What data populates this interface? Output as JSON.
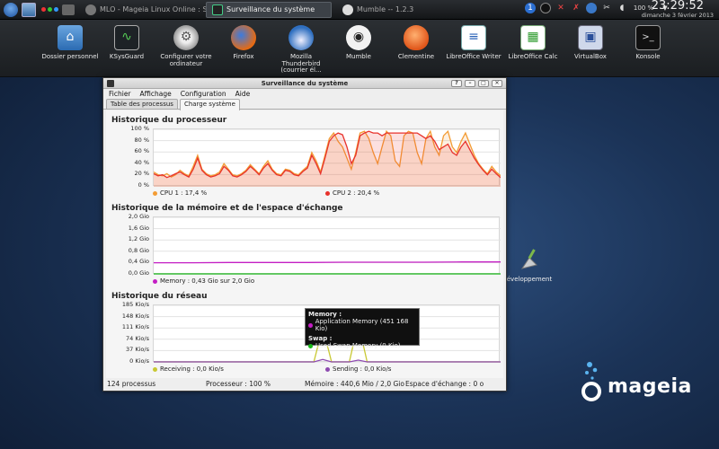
{
  "taskbar": {
    "tasks": [
      {
        "label": "MLO - Mageia Linux Online : Sujet",
        "active": false
      },
      {
        "label": "Surveillance du système",
        "active": true
      },
      {
        "label": "Mumble -- 1.2.3",
        "active": false
      }
    ],
    "volume": "100 %",
    "clock": {
      "time": "23:29:52",
      "date": "dimanche 3 février 2013"
    }
  },
  "dock": {
    "items": [
      {
        "label": "Dossier personnel",
        "icon": "home-folder-icon"
      },
      {
        "label": "KSysGuard",
        "icon": "ksysguard-icon"
      },
      {
        "label": "Configurer votre ordinateur",
        "icon": "gear-icon"
      },
      {
        "label": "Firefox",
        "icon": "firefox-icon"
      },
      {
        "label": "Mozilla Thunderbird (courrier él...",
        "icon": "thunderbird-icon"
      },
      {
        "label": "Mumble",
        "icon": "mumble-icon"
      },
      {
        "label": "Clementine",
        "icon": "clementine-icon"
      },
      {
        "label": "LibreOffice Writer",
        "icon": "writer-icon"
      },
      {
        "label": "LibreOffice Calc",
        "icon": "calc-icon"
      },
      {
        "label": "VirtualBox",
        "icon": "virtualbox-icon"
      },
      {
        "label": "Konsole",
        "icon": "terminal-icon"
      }
    ]
  },
  "window": {
    "title": "Surveillance du système",
    "menu": [
      "Fichier",
      "Affichage",
      "Configuration",
      "Aide"
    ],
    "tabs": [
      "Table des processus",
      "Charge système"
    ],
    "active_tab": "Charge système",
    "status": {
      "processes": "124 processus",
      "cpu": "Processeur : 100 %",
      "memory": "Mémoire : 440,6 Mio / 2,0 Gio",
      "swap": "Espace d'échange : 0 o"
    }
  },
  "cpu": {
    "title": "Historique du processeur",
    "legend": [
      {
        "label": "CPU 1 : 17,4 %",
        "color": "#f39c34"
      },
      {
        "label": "CPU 2 : 20,4 %",
        "color": "#e8322c"
      }
    ]
  },
  "memory": {
    "title": "Historique de la mémoire et de l'espace d'échange",
    "legend": [
      {
        "label": "Memory : 0,43 Gio sur 2,0 Gio",
        "color": "#c41ec4"
      }
    ],
    "tooltip": {
      "memory_header": "Memory :",
      "memory_row": "Application Memory (451 168 Kio)",
      "swap_header": "Swap :",
      "swap_row": "Used Swap Memory (0 Kio)"
    }
  },
  "network": {
    "title": "Historique du réseau",
    "legend": [
      {
        "label": "Receiving : 0,0 Kio/s",
        "color": "#c8c832"
      },
      {
        "label": "Sending : 0,0 Kio/s",
        "color": "#8e4bb0"
      }
    ]
  },
  "desktop": {
    "dev_label": "éveloppement",
    "brand": "mageia"
  },
  "chart_data": [
    {
      "type": "area",
      "title": "Historique du processeur",
      "y_ticks": [
        "100 %",
        "80 %",
        "60 %",
        "40 %",
        "20 %",
        "0 %"
      ],
      "ylim": [
        0,
        100
      ],
      "x": [
        0,
        1,
        2,
        3,
        4,
        5,
        6,
        7,
        8,
        9,
        10,
        11,
        12,
        13,
        14,
        15,
        16,
        17,
        18,
        19,
        20,
        21,
        22,
        23,
        24,
        25,
        26,
        27,
        28,
        29,
        30,
        31,
        32,
        33,
        34,
        35,
        36,
        37,
        38,
        39,
        40,
        41,
        42,
        43,
        44,
        45,
        46,
        47,
        48,
        49,
        50,
        51,
        52,
        53,
        54,
        55,
        56,
        57,
        58,
        59,
        60,
        61,
        62,
        63,
        64,
        65,
        66,
        67,
        68,
        69,
        70,
        71,
        72,
        73,
        74,
        75,
        76,
        77,
        78,
        79
      ],
      "series": [
        {
          "name": "CPU 1",
          "color": "#f39c34",
          "values": [
            25,
            20,
            18,
            22,
            16,
            20,
            28,
            22,
            18,
            35,
            55,
            30,
            22,
            18,
            20,
            25,
            40,
            30,
            20,
            18,
            22,
            28,
            38,
            30,
            22,
            35,
            45,
            30,
            22,
            20,
            30,
            28,
            22,
            20,
            28,
            35,
            60,
            45,
            25,
            55,
            85,
            95,
            80,
            70,
            50,
            30,
            60,
            95,
            98,
            85,
            60,
            40,
            70,
            98,
            90,
            45,
            35,
            90,
            98,
            95,
            60,
            40,
            85,
            98,
            70,
            55,
            90,
            98,
            70,
            60,
            80,
            95,
            75,
            55,
            40,
            30,
            22,
            35,
            25,
            18
          ]
        },
        {
          "name": "CPU 2",
          "color": "#e8322c",
          "values": [
            22,
            18,
            20,
            15,
            18,
            22,
            25,
            20,
            16,
            30,
            50,
            28,
            20,
            16,
            18,
            22,
            35,
            28,
            18,
            16,
            20,
            26,
            35,
            28,
            20,
            32,
            40,
            28,
            20,
            18,
            28,
            26,
            20,
            18,
            26,
            32,
            55,
            40,
            22,
            50,
            80,
            90,
            95,
            92,
            70,
            40,
            55,
            90,
            95,
            98,
            95,
            95,
            90,
            95,
            95,
            95,
            95,
            95,
            95,
            95,
            95,
            90,
            85,
            90,
            80,
            65,
            70,
            75,
            60,
            55,
            70,
            80,
            65,
            50,
            38,
            28,
            20,
            30,
            22,
            15
          ]
        }
      ]
    },
    {
      "type": "line",
      "title": "Historique de la mémoire et de l'espace d'échange",
      "y_ticks": [
        "2,0 Gio",
        "1,6 Gio",
        "1,2 Gio",
        "0,8 Gio",
        "0,4 Gio",
        "0,0 Gio"
      ],
      "ylim": [
        0,
        2.0
      ],
      "series": [
        {
          "name": "Memory",
          "color": "#c41ec4",
          "values": [
            0.4,
            0.4,
            0.41,
            0.41,
            0.41,
            0.42,
            0.42,
            0.42,
            0.43,
            0.43
          ]
        },
        {
          "name": "Swap",
          "color": "#18b818",
          "values": [
            0,
            0,
            0,
            0,
            0,
            0,
            0,
            0,
            0,
            0
          ]
        }
      ]
    },
    {
      "type": "line",
      "title": "Historique du réseau",
      "y_ticks": [
        "185 Kio/s",
        "148 Kio/s",
        "111 Kio/s",
        "74 Kio/s",
        "37 Kio/s",
        "0 Kio/s"
      ],
      "ylim": [
        0,
        185
      ],
      "x": [
        0,
        1,
        2,
        3,
        4,
        5,
        6,
        7,
        8,
        9,
        10,
        11,
        12,
        13,
        14,
        15,
        16,
        17,
        18,
        19,
        20,
        21,
        22,
        23,
        24,
        25,
        26,
        27,
        28,
        29,
        30,
        31,
        32,
        33,
        34,
        35,
        36,
        37,
        38,
        39
      ],
      "series": [
        {
          "name": "Receiving",
          "color": "#c8c832",
          "values": [
            0,
            0,
            0,
            0,
            0,
            0,
            0,
            0,
            0,
            0,
            0,
            0,
            0,
            0,
            0,
            0,
            0,
            0,
            0,
            115,
            0,
            0,
            0,
            130,
            0,
            0,
            0,
            0,
            0,
            0,
            0,
            0,
            0,
            0,
            0,
            0,
            0,
            0,
            0,
            0
          ]
        },
        {
          "name": "Sending",
          "color": "#8e4bb0",
          "values": [
            0,
            0,
            0,
            0,
            0,
            0,
            0,
            0,
            0,
            0,
            0,
            0,
            0,
            0,
            0,
            0,
            0,
            0,
            0,
            8,
            0,
            0,
            0,
            6,
            0,
            0,
            0,
            0,
            0,
            0,
            0,
            0,
            0,
            0,
            0,
            0,
            0,
            0,
            0,
            0
          ]
        }
      ]
    }
  ]
}
